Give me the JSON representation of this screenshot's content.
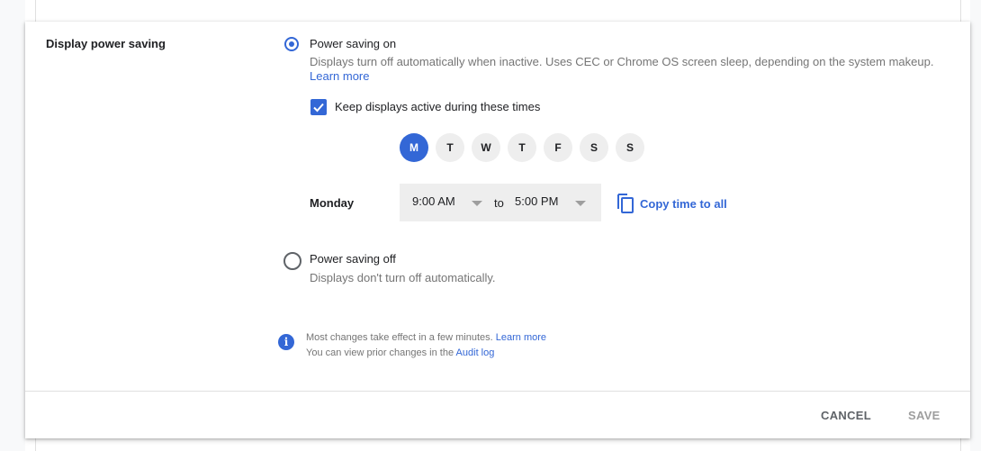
{
  "setting": {
    "label": "Display power saving",
    "options": [
      {
        "title": "Power saving on",
        "selected": true,
        "description": "Displays turn off automatically when inactive. Uses CEC or Chrome OS screen sleep, depending on the system makeup.",
        "link": "Learn more"
      },
      {
        "title": "Power saving off",
        "selected": false,
        "description": "Displays don't turn off automatically."
      }
    ],
    "keep_active": {
      "label": "Keep displays active during these times",
      "checked": true
    },
    "days": [
      {
        "label": "M",
        "selected": true
      },
      {
        "label": "T",
        "selected": false
      },
      {
        "label": "W",
        "selected": false
      },
      {
        "label": "T",
        "selected": false
      },
      {
        "label": "F",
        "selected": false
      },
      {
        "label": "S",
        "selected": false
      },
      {
        "label": "S",
        "selected": false
      }
    ],
    "schedule": {
      "day_label": "Monday",
      "start": "9:00 AM",
      "to": "to",
      "end": "5:00 PM",
      "copy_label": "Copy time to all"
    }
  },
  "info": {
    "line1": "Most changes take effect in a few minutes.",
    "line1_link": "Learn more",
    "line2": "You can view prior changes in the",
    "line2_link": "Audit log"
  },
  "footer": {
    "cancel": "CANCEL",
    "save": "SAVE"
  },
  "colors": {
    "accent": "#3367d6",
    "chip": "#eeeeee"
  }
}
